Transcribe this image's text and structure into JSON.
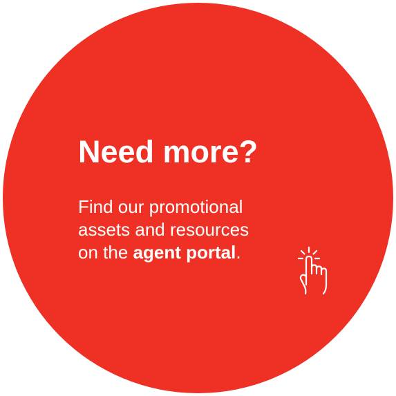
{
  "colors": {
    "circle": "#ee3124",
    "text": "#ffffff",
    "background": "#ffffff"
  },
  "callout": {
    "headline": "Need more?",
    "line1": "Find our promotional",
    "line2": "assets and resources",
    "line3_prefix": "on the ",
    "link_text": "agent portal",
    "line3_suffix": "."
  },
  "icons": {
    "pointer": "pointing-hand-click-icon"
  }
}
